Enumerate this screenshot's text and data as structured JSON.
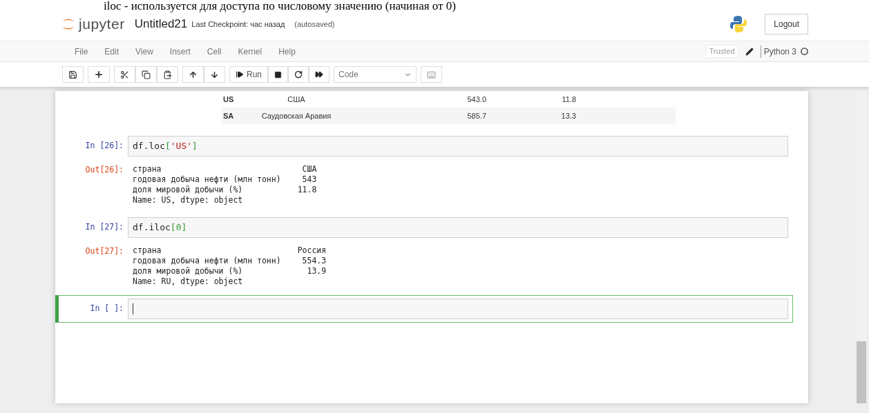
{
  "document_text": "iloc - используется для доступа по числовому значению (начиная от 0)",
  "header": {
    "logo_text": "jupyter",
    "notebook_name": "Untitled21",
    "checkpoint": "Last Checkpoint: час назад",
    "autosave": "(autosaved)",
    "logout": "Logout"
  },
  "menu": {
    "items": [
      "File",
      "Edit",
      "View",
      "Insert",
      "Cell",
      "Kernel",
      "Help"
    ],
    "trusted": "Trusted",
    "kernel": "Python 3"
  },
  "toolbar": {
    "run_label": "Run",
    "cell_type": "Code"
  },
  "table": {
    "rows": [
      {
        "index": "US",
        "country": "США",
        "production": "543.0",
        "share": "11.8"
      },
      {
        "index": "SA",
        "country": "Саудовская Аравия",
        "production": "585.7",
        "share": "13.3"
      }
    ]
  },
  "cells": [
    {
      "prompt": "In [26]:",
      "selected": false,
      "code": [
        {
          "text": "df.loc",
          "kind": "name"
        },
        {
          "text": "[",
          "kind": "bracket"
        },
        {
          "text": "'US'",
          "kind": "string"
        },
        {
          "text": "]",
          "kind": "bracket"
        }
      ],
      "output": {
        "prompt": "Out[26]:",
        "rows": [
          {
            "label": "страна",
            "value": "США"
          },
          {
            "label": "годовая добыча нефти (млн тонн)",
            "value": "543"
          },
          {
            "label": "доля мировой добычи (%)",
            "value": "11.8"
          }
        ],
        "footer": "Name: US, dtype: object"
      }
    },
    {
      "prompt": "In [27]:",
      "selected": false,
      "code": [
        {
          "text": "df.iloc",
          "kind": "name"
        },
        {
          "text": "[",
          "kind": "bracket"
        },
        {
          "text": "0",
          "kind": "number"
        },
        {
          "text": "]",
          "kind": "bracket"
        }
      ],
      "output": {
        "prompt": "Out[27]:",
        "rows": [
          {
            "label": "страна",
            "value": "Россия"
          },
          {
            "label": "годовая добыча нефти (млн тонн)",
            "value": "554.3"
          },
          {
            "label": "доля мировой добычи (%)",
            "value": "13.9"
          }
        ],
        "footer": "Name: RU, dtype: object"
      }
    },
    {
      "prompt": "In [ ]:",
      "selected": true
    }
  ]
}
